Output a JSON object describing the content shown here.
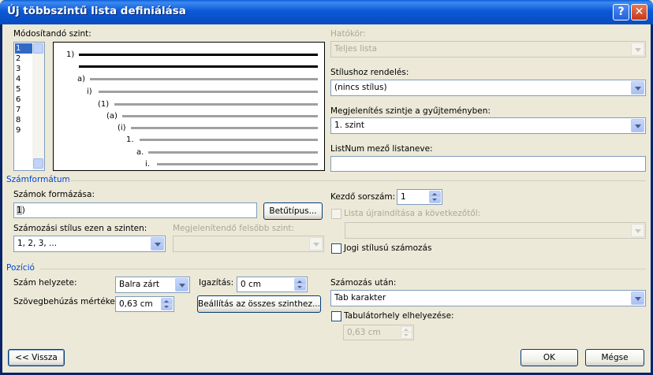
{
  "window": {
    "title": "Új többszintű lista definiálása",
    "help_glyph": "?",
    "close_glyph": "✕"
  },
  "level": {
    "label": "Módosítandó szint:",
    "items": [
      "1",
      "2",
      "3",
      "4",
      "5",
      "6",
      "7",
      "8",
      "9"
    ],
    "selected": "1"
  },
  "preview": {
    "labels": [
      "1)",
      "a)",
      "i)",
      "(1)",
      "(a)",
      "(i)",
      "1.",
      "a.",
      "i."
    ]
  },
  "scope": {
    "label": "Hatókör:",
    "value": "Teljes lista"
  },
  "link_style": {
    "label": "Stílushoz rendelés:",
    "value": "(nincs stílus)"
  },
  "gallery_level": {
    "label": "Megjelenítés szintje a gyűjteményben:",
    "value": "1. szint"
  },
  "listnum": {
    "label": "ListNum mező listaneve:",
    "value": ""
  },
  "number_format": {
    "group_title": "Számformátum",
    "format_label": "Számok formázása:",
    "format_number": "1",
    "format_suffix": ")",
    "font_button": "Betűtípus...",
    "style_label": "Számozási stílus ezen a szinten:",
    "style_value": "1, 2, 3, ...",
    "include_label": "Megjelenítendő felsőbb szint:",
    "include_value": "",
    "start_label": "Kezdő sorszám:",
    "start_value": "1",
    "restart_label": "Lista újraindítása a következőtől:",
    "restart_value": "",
    "legal_label": "Jogi stílusú számozás"
  },
  "position": {
    "group_title": "Pozíció",
    "alignment_label": "Szám helyzete:",
    "alignment_value": "Balra zárt",
    "aligned_at_label": "Igazítás:",
    "aligned_at_value": "0 cm",
    "indent_label": "Szövegbehúzás mértéke:",
    "indent_value": "0,63 cm",
    "set_all_button": "Beállítás az összes szinthez...",
    "follow_label": "Számozás után:",
    "follow_value": "Tab karakter",
    "tab_label": "Tabulátorhely elhelyezése:",
    "tab_value": "0,63 cm"
  },
  "footer": {
    "back_button": "<< Vissza",
    "ok_button": "OK",
    "cancel_button": "Mégse"
  }
}
